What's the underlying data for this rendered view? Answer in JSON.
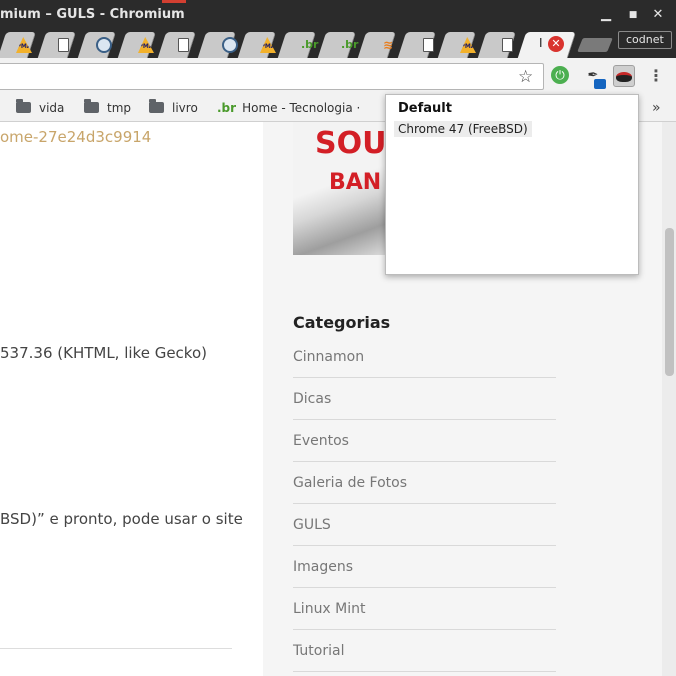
{
  "window": {
    "title": "mium – GULS - Chromium",
    "controls": {
      "minimize": "▁",
      "maximize": "■",
      "close": "✕"
    }
  },
  "tabs": [
    {
      "icon": "pma-icon"
    },
    {
      "icon": "page-icon"
    },
    {
      "icon": "globe-icon"
    },
    {
      "icon": "pma-icon"
    },
    {
      "icon": "page-icon"
    },
    {
      "icon": "globe-icon"
    },
    {
      "icon": "pma-icon"
    },
    {
      "icon": "br-icon"
    },
    {
      "icon": "br-icon"
    },
    {
      "icon": "stackoverflow-icon"
    },
    {
      "icon": "page-icon"
    },
    {
      "icon": "pma-icon"
    },
    {
      "icon": "page-icon"
    },
    {
      "icon": "active-tab",
      "label": "I"
    }
  ],
  "profile": {
    "name": "codnet"
  },
  "bookmarks": [
    {
      "label": "vida",
      "icon": "folder-icon"
    },
    {
      "label": "tmp",
      "icon": "folder-icon"
    },
    {
      "label": "livro",
      "icon": "folder-icon"
    },
    {
      "label": "Home - Tecnologia ·",
      "icon": "br-icon"
    }
  ],
  "bookmarks_more": "»",
  "article": {
    "link_fragment": "ome-27e24d3c9914",
    "line1": "537.36 (KHTML, like Gecko)",
    "line2": "BSD)” e pronto, pode usar o site"
  },
  "promo": {
    "text1": "SOU",
    "text2": "BAN"
  },
  "sidebar": {
    "categories_title": "Categorias",
    "categories": [
      "Cinnamon",
      "Dicas",
      "Eventos",
      "Galeria de Fotos",
      "GULS",
      "Imagens",
      "Linux Mint",
      "Tutorial"
    ]
  },
  "popup": {
    "title": "Default",
    "option": "Chrome 47 (FreeBSD)"
  }
}
